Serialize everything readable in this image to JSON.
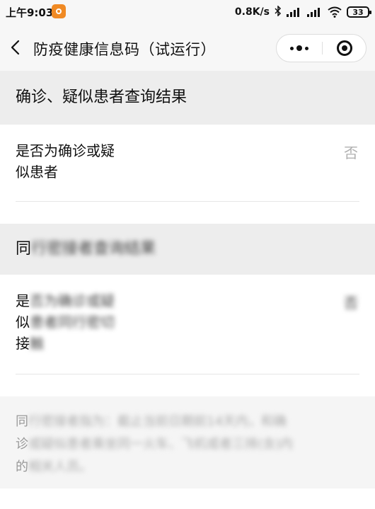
{
  "status_bar": {
    "time": "上午9:03",
    "net_speed": "0.8K/s",
    "battery": "33"
  },
  "nav": {
    "title": "防疫健康信息码（试运行）"
  },
  "section1": {
    "title": "确诊、疑似患者查询结果",
    "row": {
      "label_line1": "是否为确诊或疑",
      "label_line2": "似患者",
      "value": "否"
    }
  },
  "section2": {
    "title_visible": "同",
    "title_blurred": "行密接者查询结果",
    "row": {
      "line1_visible": "是",
      "line1_blurred": "否为确诊或疑",
      "line2_visible": "似",
      "line2_blurred": "患者同行密切",
      "line3_visible": "接",
      "line3_blurred": "触",
      "value_blurred": "否"
    }
  },
  "note": {
    "line1_visible": "同",
    "line1_blurred": "行密接者指为：截止当前日期前14天内，和确",
    "line2_visible": "诊",
    "line2_blurred": "或疑似患者乘坐同一火车、飞机或者三排(含)内",
    "line3_visible": "的",
    "line3_blurred": "相关人员。"
  },
  "colors": {
    "app_badge": "#f08a24",
    "section_bg": "#ededed",
    "nav_bg": "#f7f7f7",
    "value_grey": "#b0b0b0"
  },
  "icons": {
    "back": "chevron-left-icon",
    "more": "more-dots-icon",
    "close": "target-ring-icon",
    "bluetooth": "bluetooth-icon",
    "wifi": "wifi-icon"
  }
}
